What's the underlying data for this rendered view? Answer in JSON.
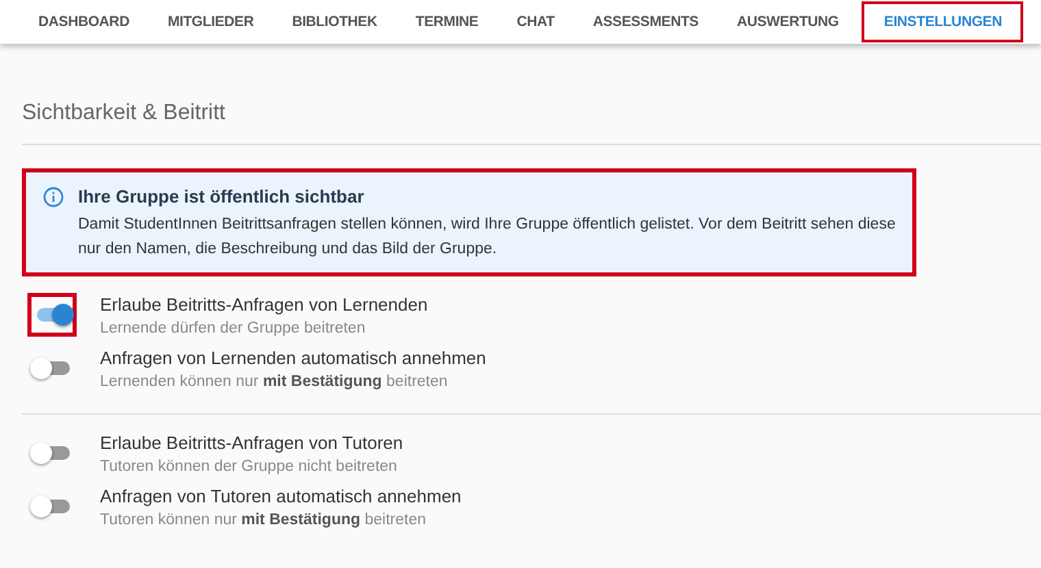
{
  "tabs": [
    {
      "label": "DASHBOARD",
      "selected": false,
      "highlighted": false
    },
    {
      "label": "MITGLIEDER",
      "selected": false,
      "highlighted": false
    },
    {
      "label": "BIBLIOTHEK",
      "selected": false,
      "highlighted": false
    },
    {
      "label": "TERMINE",
      "selected": false,
      "highlighted": false
    },
    {
      "label": "CHAT",
      "selected": false,
      "highlighted": false
    },
    {
      "label": "ASSESSMENTS",
      "selected": false,
      "highlighted": false
    },
    {
      "label": "AUSWERTUNG",
      "selected": false,
      "highlighted": false
    },
    {
      "label": "EINSTELLUNGEN",
      "selected": true,
      "highlighted": true
    }
  ],
  "section": {
    "title": "Sichtbarkeit & Beitritt"
  },
  "notice": {
    "title": "Ihre Gruppe ist öffentlich sichtbar",
    "text": "Damit StudentInnen Beitrittsanfragen stellen können, wird Ihre Gruppe öffentlich gelistet. Vor dem Beitritt sehen diese nur den Namen, die Beschreibung und das Bild der Gruppe.",
    "highlighted": true
  },
  "groups": [
    {
      "toggles": [
        {
          "label": "Erlaube Beitritts-Anfragen von Lernenden",
          "hint": "Lernende dürfen der Gruppe beitreten",
          "on": true,
          "highlighted": true
        },
        {
          "label": "Anfragen von Lernenden automatisch annehmen",
          "hint": "Lernenden können nur **mit Bestätigung** beitreten",
          "on": false,
          "highlighted": false
        }
      ]
    },
    {
      "toggles": [
        {
          "label": "Erlaube Beitritts-Anfragen von Tutoren",
          "hint": "Tutoren können der Gruppe nicht beitreten",
          "on": false,
          "highlighted": false
        },
        {
          "label": "Anfragen von Tutoren automatisch annehmen",
          "hint": "Tutoren können nur **mit Bestätigung** beitreten",
          "on": false,
          "highlighted": false
        }
      ]
    }
  ]
}
